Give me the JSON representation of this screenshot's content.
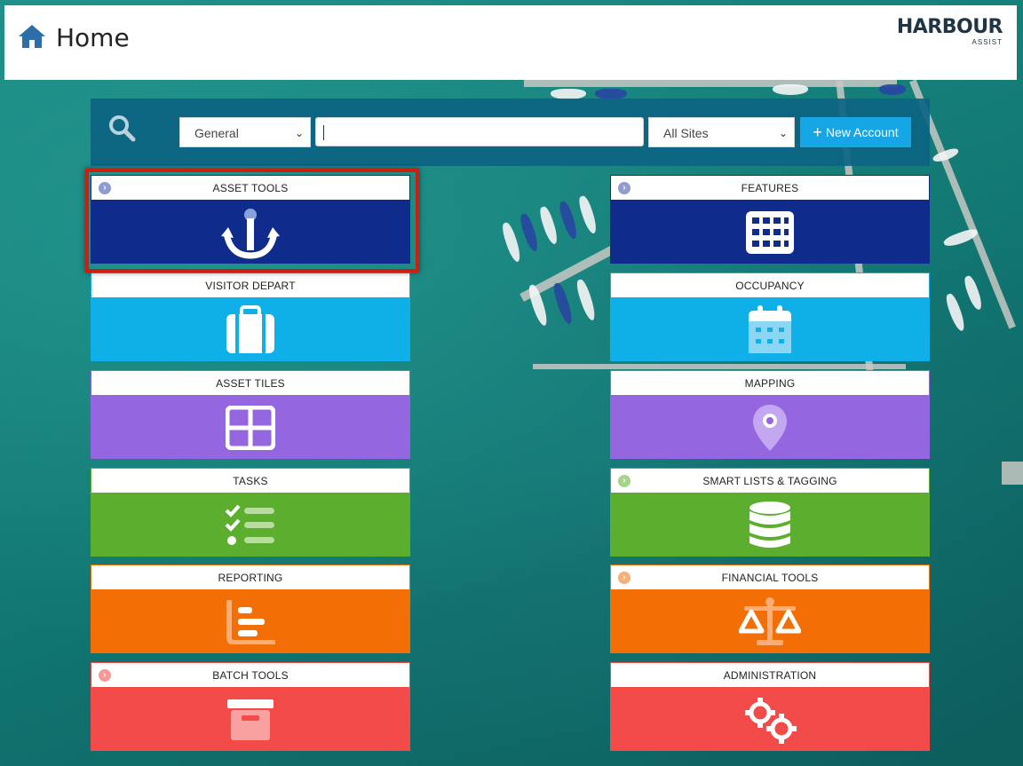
{
  "header": {
    "title": "Home",
    "logo_main": "HARBOUR",
    "logo_sub": "ASSIST"
  },
  "search": {
    "type_value": "General",
    "query_value": "",
    "site_value": "All Sites",
    "new_account_label": "New Account"
  },
  "tiles": [
    {
      "label": "ASSET TOOLS",
      "color": "#0f2b8c",
      "icon": "anchor-icon",
      "expandable": true,
      "dot": "#8e9ccf"
    },
    {
      "label": "FEATURES",
      "color": "#0f2b8c",
      "icon": "grid-icon",
      "expandable": true,
      "dot": "#8e9ccf"
    },
    {
      "label": "VISITOR DEPART",
      "color": "#0fb0e8",
      "icon": "suitcase-icon",
      "expandable": false
    },
    {
      "label": "OCCUPANCY",
      "color": "#0fb0e8",
      "icon": "calendar-icon",
      "expandable": false
    },
    {
      "label": "ASSET TILES",
      "color": "#9466e0",
      "icon": "tiles-icon",
      "expandable": false
    },
    {
      "label": "MAPPING",
      "color": "#9466e0",
      "icon": "map-pin-icon",
      "expandable": false
    },
    {
      "label": "TASKS",
      "color": "#5cae2e",
      "icon": "checklist-icon",
      "expandable": false
    },
    {
      "label": "SMART LISTS & TAGGING",
      "color": "#5cae2e",
      "icon": "database-icon",
      "expandable": true,
      "dot": "#a5d38a"
    },
    {
      "label": "REPORTING",
      "color": "#f36f05",
      "icon": "bar-chart-icon",
      "expandable": false
    },
    {
      "label": "FINANCIAL TOOLS",
      "color": "#f36f05",
      "icon": "scales-icon",
      "expandable": true,
      "dot": "#f9ae78"
    },
    {
      "label": "BATCH TOOLS",
      "color": "#f34a4a",
      "icon": "archive-box-icon",
      "expandable": true,
      "dot": "#f99898"
    },
    {
      "label": "ADMINISTRATION",
      "color": "#f34a4a",
      "icon": "gears-icon",
      "expandable": false
    }
  ]
}
